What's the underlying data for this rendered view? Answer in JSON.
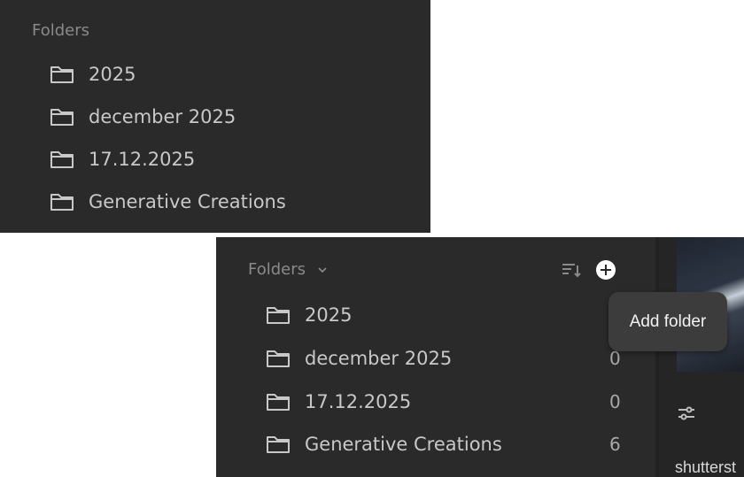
{
  "top_panel": {
    "section_title": "Folders",
    "folders": [
      {
        "label": "2025"
      },
      {
        "label": "december 2025"
      },
      {
        "label": "17.12.2025"
      },
      {
        "label": "Generative Creations"
      }
    ]
  },
  "bottom_panel": {
    "section_title": "Folders",
    "folders": [
      {
        "label": "2025",
        "count": ""
      },
      {
        "label": "december 2025",
        "count": "0"
      },
      {
        "label": "17.12.2025",
        "count": "0"
      },
      {
        "label": "Generative Creations",
        "count": "6"
      }
    ],
    "tooltip": "Add folder",
    "right_label": "shutterst"
  },
  "icons": {
    "folder": "folder-icon",
    "chevron": "chevron-down-icon",
    "sort": "sort-icon",
    "add": "add-folder-icon",
    "filter": "sliders-icon"
  },
  "colors": {
    "panel_bg": "#2a2a2a",
    "text": "#c8c8c8",
    "muted": "#8a8a8a"
  }
}
